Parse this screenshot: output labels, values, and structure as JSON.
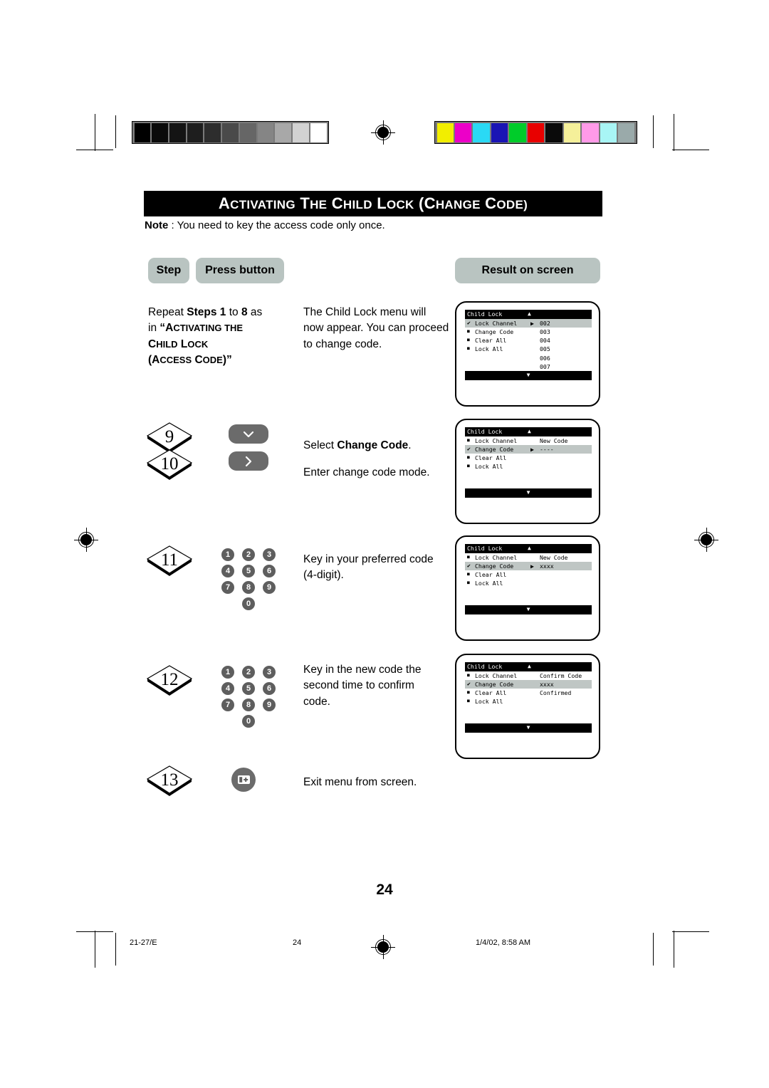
{
  "document": {
    "title": "Activating the Child Lock (Change Code)",
    "title_parts": [
      {
        "cap": "A",
        "rest": "CTIVATING"
      },
      {
        "cap": " T",
        "rest": "HE"
      },
      {
        "cap": " C",
        "rest": "HILD"
      },
      {
        "cap": " L",
        "rest": "OCK"
      },
      {
        "cap": " (C",
        "rest": "HANGE"
      },
      {
        "cap": " C",
        "rest": "ODE)"
      }
    ],
    "note_label": "Note",
    "note_text": " : You need to key the access code only once.",
    "page_number": "24"
  },
  "table_headers": {
    "step": "Step",
    "press_button": "Press button",
    "result_on_screen": "Result on screen"
  },
  "steps": [
    {
      "numbers": [],
      "instruction_lines": [
        "Repeat Steps 1 to 8 as",
        "in “Activating the",
        "Child Lock",
        "(Access Code)”"
      ],
      "result_lines": [
        "The Child Lock menu will",
        "now appear. You can proceed",
        "to change code."
      ],
      "button_type": "none"
    },
    {
      "numbers": [
        "9",
        "10"
      ],
      "instruction_lines": [
        "Select Change Code.",
        "",
        "Enter change code  mode."
      ],
      "button_type": "chevrons",
      "buttons": [
        "chevron-down",
        "chevron-right"
      ]
    },
    {
      "numbers": [
        "11"
      ],
      "instruction_lines": [
        "Key in your preferred code",
        "(4-digit)."
      ],
      "button_type": "keypad"
    },
    {
      "numbers": [
        "12"
      ],
      "instruction_lines": [
        "Key in the new code the",
        "second time to confirm",
        "code."
      ],
      "button_type": "keypad"
    },
    {
      "numbers": [
        "13"
      ],
      "instruction_lines": [
        "Exit menu from screen."
      ],
      "button_type": "menu-round"
    }
  ],
  "keypad": {
    "rows": [
      [
        "1",
        "2",
        "3"
      ],
      [
        "4",
        "5",
        "6"
      ],
      [
        "7",
        "8",
        "9"
      ]
    ],
    "zero": "0"
  },
  "screens": [
    {
      "title": "Child Lock",
      "up_arrow": "▲",
      "down_arrow": "▼",
      "items": [
        {
          "marker": "check",
          "label": "Lock Channel",
          "arrow": "▶",
          "value": "002",
          "selected": true
        },
        {
          "marker": "square",
          "label": "Change Code",
          "arrow": "",
          "value": "003",
          "selected": false
        },
        {
          "marker": "square",
          "label": "Clear All",
          "arrow": "",
          "value": "004",
          "selected": false
        },
        {
          "marker": "square",
          "label": "Lock All",
          "arrow": "",
          "value": "005",
          "selected": false
        }
      ],
      "extra_values": [
        "006",
        "007"
      ]
    },
    {
      "title": "Child Lock",
      "up_arrow": "▲",
      "down_arrow": "▼",
      "items": [
        {
          "marker": "square",
          "label": "Lock Channel",
          "arrow": "",
          "value": "New Code",
          "selected": false
        },
        {
          "marker": "check",
          "label": "Change Code",
          "arrow": "▶",
          "value": "----",
          "selected": true
        },
        {
          "marker": "square",
          "label": "Clear All",
          "arrow": "",
          "value": "",
          "selected": false
        },
        {
          "marker": "square",
          "label": "Lock All",
          "arrow": "",
          "value": "",
          "selected": false
        }
      ],
      "extra_values": []
    },
    {
      "title": "Child Lock",
      "up_arrow": "▲",
      "down_arrow": "▼",
      "items": [
        {
          "marker": "square",
          "label": "Lock Channel",
          "arrow": "",
          "value": "New Code",
          "selected": false
        },
        {
          "marker": "check",
          "label": "Change Code",
          "arrow": "▶",
          "value": "xxxx",
          "selected": true
        },
        {
          "marker": "square",
          "label": "Clear All",
          "arrow": "",
          "value": "",
          "selected": false
        },
        {
          "marker": "square",
          "label": "Lock All",
          "arrow": "",
          "value": "",
          "selected": false
        }
      ],
      "extra_values": []
    },
    {
      "title": "Child Lock",
      "up_arrow": "▲",
      "down_arrow": "▼",
      "items": [
        {
          "marker": "square",
          "label": "Lock Channel",
          "arrow": "",
          "value": "Confirm Code",
          "selected": false
        },
        {
          "marker": "check",
          "label": "Change Code",
          "arrow": "",
          "value": "xxxx",
          "selected": true
        },
        {
          "marker": "square",
          "label": "Clear All",
          "arrow": "",
          "value": "Confirmed",
          "selected": false
        },
        {
          "marker": "square",
          "label": "Lock All",
          "arrow": "",
          "value": "",
          "selected": false
        }
      ],
      "extra_values": []
    }
  ],
  "print_marks": {
    "grayscale_swatches": [
      "#000000",
      "#0a0a0a",
      "#141414",
      "#1e1e1e",
      "#2d2d2d",
      "#4a4a4a",
      "#666666",
      "#858585",
      "#a8a8a8",
      "#d2d2d2",
      "#ffffff"
    ],
    "color_swatches": [
      "#f2ee00",
      "#ec00c8",
      "#2ad9f5",
      "#1a14b4",
      "#00cc2a",
      "#e80000",
      "#0a0a0a",
      "#f5f09a",
      "#ff9ae8",
      "#a8f5f5",
      "#9aaaaa"
    ]
  },
  "footer": {
    "job": "21-27/E",
    "page": "24",
    "timestamp": "1/4/02, 8:58 AM"
  }
}
